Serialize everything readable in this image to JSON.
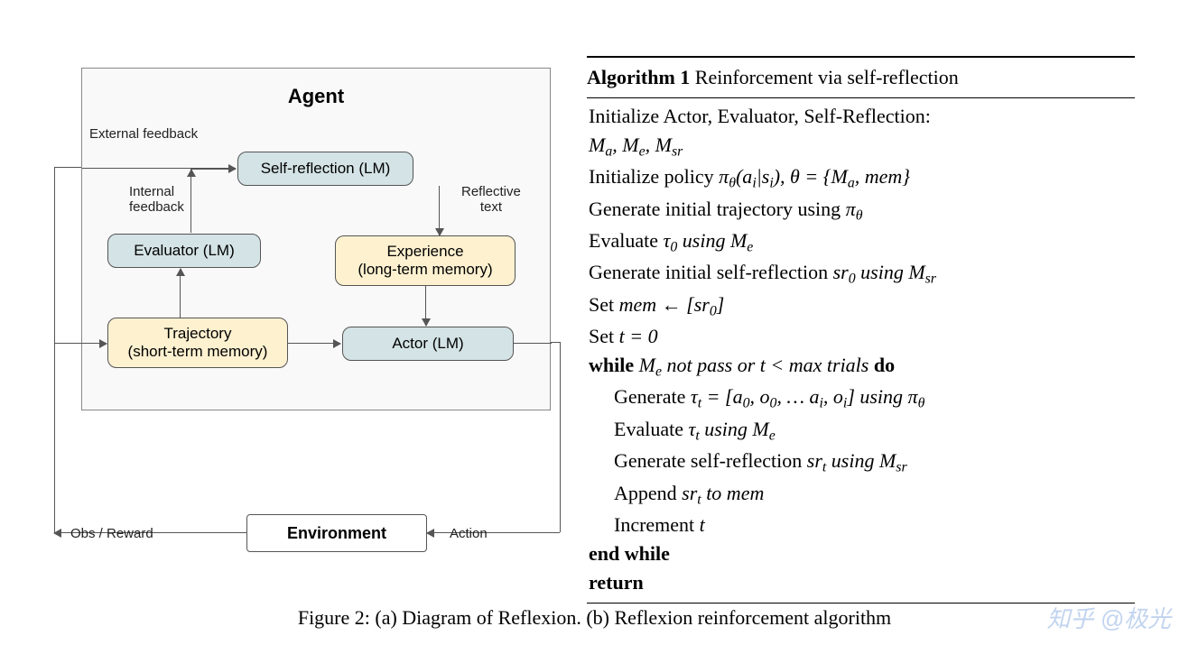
{
  "diagram": {
    "agent_title": "Agent",
    "boxes": {
      "self_reflection": "Self-reflection (LM)",
      "evaluator": "Evaluator (LM)",
      "experience_line1": "Experience",
      "experience_line2": "(long-term memory)",
      "trajectory_line1": "Trajectory",
      "trajectory_line2": "(short-term memory)",
      "actor": "Actor (LM)",
      "environment": "Environment"
    },
    "labels": {
      "external_feedback": "External feedback",
      "internal_feedback_l1": "Internal",
      "internal_feedback_l2": "feedback",
      "reflective_text_l1": "Reflective",
      "reflective_text_l2": "text",
      "obs_reward": "Obs / Reward",
      "action": "Action"
    }
  },
  "algorithm": {
    "title_label": "Algorithm 1",
    "title_rest": " Reinforcement via self-reflection",
    "lines": {
      "l1": "Initialize Actor, Evaluator, Self-Reflection:",
      "l2_pre": "",
      "l2_math": "M<sub>a</sub>, M<sub>e</sub>, M<sub>sr</sub>",
      "l3_pre": "Initialize policy ",
      "l3_math": "π<sub>θ</sub>(a<sub>i</sub>|s<sub>i</sub>), θ = {M<sub>a</sub>, mem}",
      "l4_pre": "Generate initial trajectory using ",
      "l4_math": "π<sub>θ</sub>",
      "l5_pre": "Evaluate ",
      "l5_math": "τ<sub>0</sub> using M<sub>e</sub>",
      "l6_pre": "Generate initial self-reflection ",
      "l6_math": "sr<sub>0</sub> using M<sub>sr</sub>",
      "l7_pre": "Set ",
      "l7_math": "mem ← [sr<sub>0</sub>]",
      "l8_pre": "Set ",
      "l8_math": "t = 0",
      "l9_pre": "while ",
      "l9_math": "M<sub>e</sub> not pass or t < max trials",
      "l9_post": " do",
      "l10_pre": "Generate ",
      "l10_math": "τ<sub>t</sub> = [a<sub>0</sub>, o<sub>0</sub>, … a<sub>i</sub>, o<sub>i</sub>] using π<sub>θ</sub>",
      "l11_pre": "Evaluate ",
      "l11_math": "τ<sub>t</sub> using M<sub>e</sub>",
      "l12_pre": "Generate self-reflection ",
      "l12_math": "sr<sub>t</sub> using M<sub>sr</sub>",
      "l13_pre": "Append ",
      "l13_math": "sr<sub>t</sub> to mem",
      "l14_pre": "Increment ",
      "l14_math": "t",
      "l15": "end while",
      "l16": "return"
    }
  },
  "caption": "Figure 2: (a) Diagram of Reflexion. (b) Reflexion reinforcement algorithm",
  "watermark": "知乎 @极光"
}
